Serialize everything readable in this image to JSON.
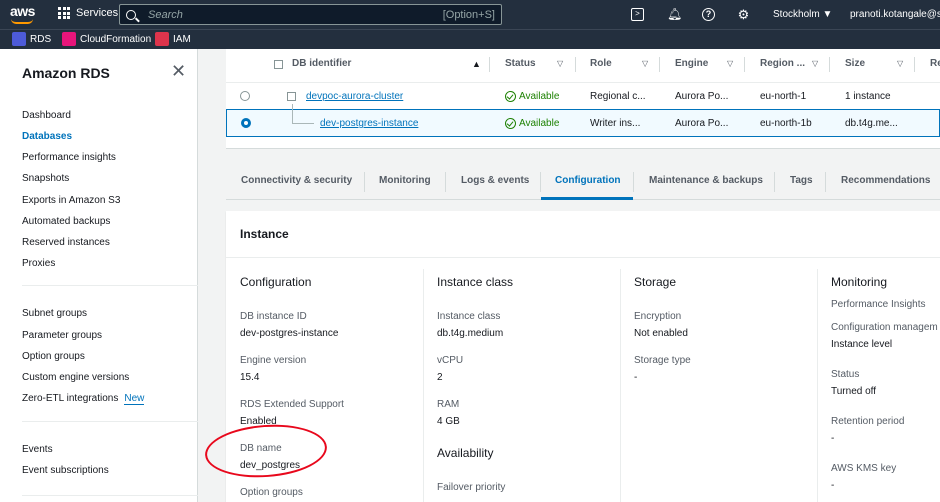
{
  "topbar": {
    "logo": "aws",
    "services_label": "Services",
    "search_placeholder": "Search",
    "search_shortcut": "[Option+S]",
    "region": "Stockholm ▼",
    "user": "pranoti.kotangale@ser"
  },
  "favorites": [
    {
      "label": "RDS",
      "color": "#4d5bd9",
      "icon": "rds-icon"
    },
    {
      "label": "CloudFormation",
      "color": "#e7157b",
      "icon": "cloudformation-icon"
    },
    {
      "label": "IAM",
      "color": "#dd344c",
      "icon": "iam-icon"
    }
  ],
  "sidebar": {
    "title": "Amazon RDS",
    "items": [
      "Dashboard",
      "Databases",
      "Performance insights",
      "Snapshots",
      "Exports in Amazon S3",
      "Automated backups",
      "Reserved instances",
      "Proxies"
    ],
    "active": "Databases",
    "items2": [
      "Subnet groups",
      "Parameter groups",
      "Option groups",
      "Custom engine versions",
      "Zero-ETL integrations"
    ],
    "new_badge": "New",
    "items3": [
      "Events",
      "Event subscriptions"
    ]
  },
  "table": {
    "headers": [
      "DB identifier",
      "Status",
      "Role",
      "Engine",
      "Region ...",
      "Size",
      "Re"
    ],
    "rows": [
      {
        "id": "devpoc-aurora-cluster",
        "status": "Available",
        "role": "Regional c...",
        "engine": "Aurora Po...",
        "region": "eu-north-1",
        "size": "1 instance"
      },
      {
        "id": "dev-postgres-instance",
        "status": "Available",
        "role": "Writer ins...",
        "engine": "Aurora Po...",
        "region": "eu-north-1b",
        "size": "db.t4g.me..."
      }
    ]
  },
  "tabs": [
    "Connectivity & security",
    "Monitoring",
    "Logs & events",
    "Configuration",
    "Maintenance & backups",
    "Tags",
    "Recommendations"
  ],
  "active_tab": "Configuration",
  "panel": {
    "title": "Instance",
    "configuration": {
      "heading": "Configuration",
      "db_instance_id_label": "DB instance ID",
      "db_instance_id": "dev-postgres-instance",
      "engine_version_label": "Engine version",
      "engine_version": "15.4",
      "extended_support_label": "RDS Extended Support",
      "extended_support": "Enabled",
      "db_name_label": "DB name",
      "db_name": "dev_postgres",
      "option_groups_label": "Option groups"
    },
    "instance_class": {
      "heading": "Instance class",
      "class_label": "Instance class",
      "class_value": "db.t4g.medium",
      "vcpu_label": "vCPU",
      "vcpu_value": "2",
      "ram_label": "RAM",
      "ram_value": "4 GB"
    },
    "availability": {
      "heading": "Availability",
      "failover_label": "Failover priority"
    },
    "storage": {
      "heading": "Storage",
      "encryption_label": "Encryption",
      "encryption_value": "Not enabled",
      "storage_type_label": "Storage type",
      "storage_type_value": "-"
    },
    "monitoring": {
      "heading": "Monitoring",
      "pi_label": "Performance Insights",
      "config_mgmt_label": "Configuration managem",
      "config_mgmt_value": "Instance level",
      "status_label": "Status",
      "status_value": "Turned off",
      "retention_label": "Retention period",
      "retention_value": "-",
      "kms_label": "AWS KMS key",
      "kms_value": "-"
    }
  }
}
